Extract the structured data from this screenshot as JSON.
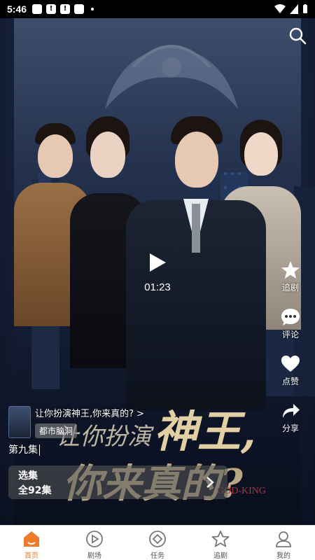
{
  "status_bar": {
    "time": "5:46"
  },
  "player": {
    "time": "01:23",
    "poster_title_line1": "让你扮演",
    "poster_title_line2": "神王,",
    "poster_title_line3": "你来真的?",
    "poster_subtitle": "GOD-KING"
  },
  "side_actions": [
    {
      "label": "追剧",
      "icon": "star-icon"
    },
    {
      "label": "评论",
      "icon": "comment-icon"
    },
    {
      "label": "点赞",
      "icon": "heart-icon"
    },
    {
      "label": "分享",
      "icon": "share-icon"
    }
  ],
  "series": {
    "title": "让你扮演神王,你来真的?",
    "arrow": ">",
    "tag": "都市脑洞",
    "episode": "第九集"
  },
  "episode_selector": {
    "label": "选集",
    "count": "全92集"
  },
  "tabs": [
    {
      "label": "首页",
      "icon": "home-icon",
      "active": true
    },
    {
      "label": "剧场",
      "icon": "theater-play-icon",
      "active": false
    },
    {
      "label": "任务",
      "icon": "task-icon",
      "active": false
    },
    {
      "label": "追剧",
      "icon": "star-outline-icon",
      "active": false
    },
    {
      "label": "我的",
      "icon": "profile-icon",
      "active": false
    }
  ],
  "colors": {
    "accent": "#ee7a2c",
    "tab_background": "#ffffff"
  }
}
